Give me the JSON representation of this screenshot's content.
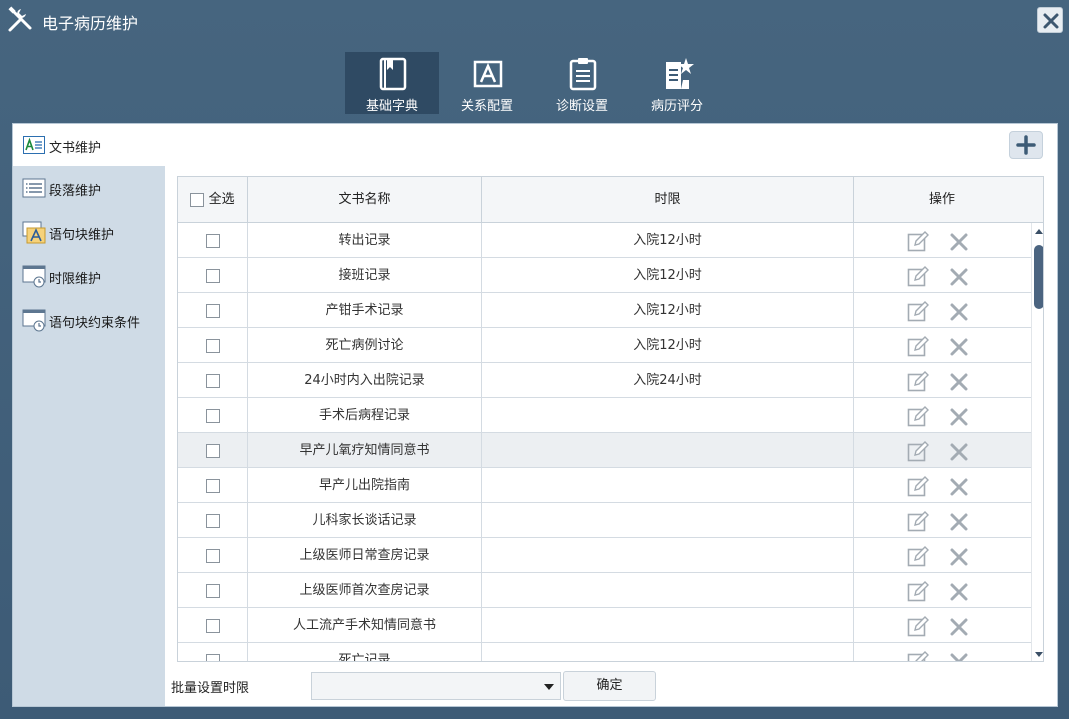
{
  "window": {
    "title": "电子病历维护"
  },
  "toolbar": {
    "items": [
      {
        "label": "基础字典",
        "icon": "book-icon",
        "active": true
      },
      {
        "label": "关系配置",
        "icon": "text-a-icon",
        "active": false
      },
      {
        "label": "诊断设置",
        "icon": "clipboard-icon",
        "active": false
      },
      {
        "label": "病历评分",
        "icon": "document-star-icon",
        "active": false
      }
    ]
  },
  "panel": {
    "title": "文书维护"
  },
  "sidebar": {
    "items": [
      {
        "label": "段落维护",
        "icon": "list-icon"
      },
      {
        "label": "语句块维护",
        "icon": "text-block-icon"
      },
      {
        "label": "时限维护",
        "icon": "clock-window-icon"
      },
      {
        "label": "语句块约束条件",
        "icon": "clock-window-icon"
      }
    ]
  },
  "table": {
    "select_all_label": "全选",
    "headers": {
      "name": "文书名称",
      "limit": "时限",
      "ops": "操作"
    },
    "rows": [
      {
        "name": "转出记录",
        "limit": "入院12小时"
      },
      {
        "name": "接班记录",
        "limit": "入院12小时"
      },
      {
        "name": "产钳手术记录",
        "limit": "入院12小时"
      },
      {
        "name": "死亡病例讨论",
        "limit": "入院12小时"
      },
      {
        "name": "24小时内入出院记录",
        "limit": "入院24小时"
      },
      {
        "name": "手术后病程记录",
        "limit": ""
      },
      {
        "name": "早产儿氧疗知情同意书",
        "limit": ""
      },
      {
        "name": "早产儿出院指南",
        "limit": ""
      },
      {
        "name": "儿科家长谈话记录",
        "limit": ""
      },
      {
        "name": "上级医师日常查房记录",
        "limit": ""
      },
      {
        "name": "上级医师首次查房记录",
        "limit": ""
      },
      {
        "name": "人工流产手术知情同意书",
        "limit": ""
      },
      {
        "name": "死亡记录",
        "limit": ""
      }
    ]
  },
  "bottom": {
    "batch_label": "批量设置时限",
    "select_value": "",
    "confirm_label": "确定"
  },
  "colors": {
    "title_bar": "#46657f",
    "active_tool": "#2f4a63",
    "sidebar": "#cfdbe6"
  }
}
